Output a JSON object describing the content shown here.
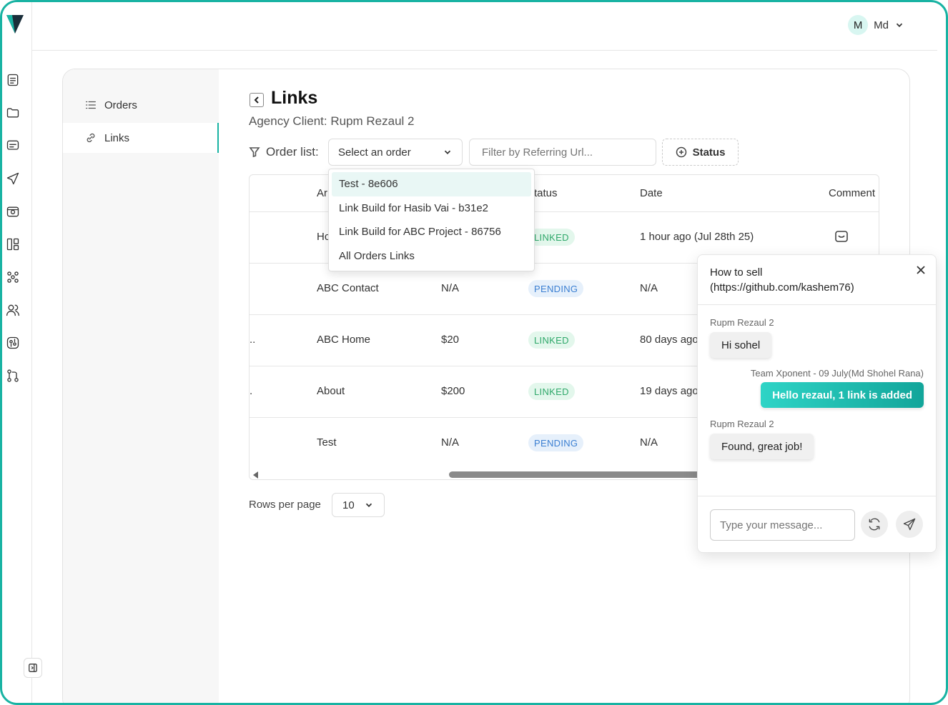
{
  "user": {
    "initial": "M",
    "name": "Md"
  },
  "subnav": {
    "orders_label": "Orders",
    "links_label": "Links"
  },
  "page": {
    "title": "Links",
    "agency_client": "Agency Client: Rupm Rezaul 2"
  },
  "filters": {
    "order_list_label": "Order list:",
    "select_placeholder": "Select an order",
    "referring_placeholder": "Filter by Referring Url...",
    "status_label": "Status"
  },
  "dropdown": {
    "options": [
      "Test - 8e606",
      "Link Build for Hasib Vai - b31e2",
      "Link Build for ABC Project - 86756",
      "All Orders Links"
    ]
  },
  "table": {
    "headers": {
      "anchor": "Ar",
      "status": "tatus",
      "date": "Date",
      "comment": "Comment"
    },
    "rows": [
      {
        "lead": "",
        "anchor": "Hc",
        "price": "",
        "status": "LINKED",
        "date": "1 hour ago (Jul 28th 25)"
      },
      {
        "lead": "",
        "anchor": "ABC Contact",
        "price": "N/A",
        "status": "PENDING",
        "date": "N/A"
      },
      {
        "lead": "..",
        "anchor": "ABC Home",
        "price": "$20",
        "status": "LINKED",
        "date": "80 days ago"
      },
      {
        "lead": ".",
        "anchor": "About",
        "price": "$200",
        "status": "LINKED",
        "date": "19 days ago"
      },
      {
        "lead": "",
        "anchor": "Test",
        "price": "N/A",
        "status": "PENDING",
        "date": "N/A"
      }
    ]
  },
  "pagination": {
    "rows_label": "Rows per page",
    "rows_value": "10"
  },
  "chat": {
    "title": "How to sell (https://github.com/kashem76)",
    "messages": [
      {
        "meta": "Rupm Rezaul 2",
        "text": "Hi sohel"
      },
      {
        "meta": "Team Xponent - 09 July(Md Shohel Rana)",
        "text": "Hello rezaul, 1 link is added"
      },
      {
        "meta": "Rupm Rezaul 2",
        "text": "Found, great job!"
      }
    ],
    "input_placeholder": "Type your message..."
  },
  "colors": {
    "accent": "#19b3a3",
    "linked": "#2fa86a",
    "pending": "#3b7fd2"
  }
}
